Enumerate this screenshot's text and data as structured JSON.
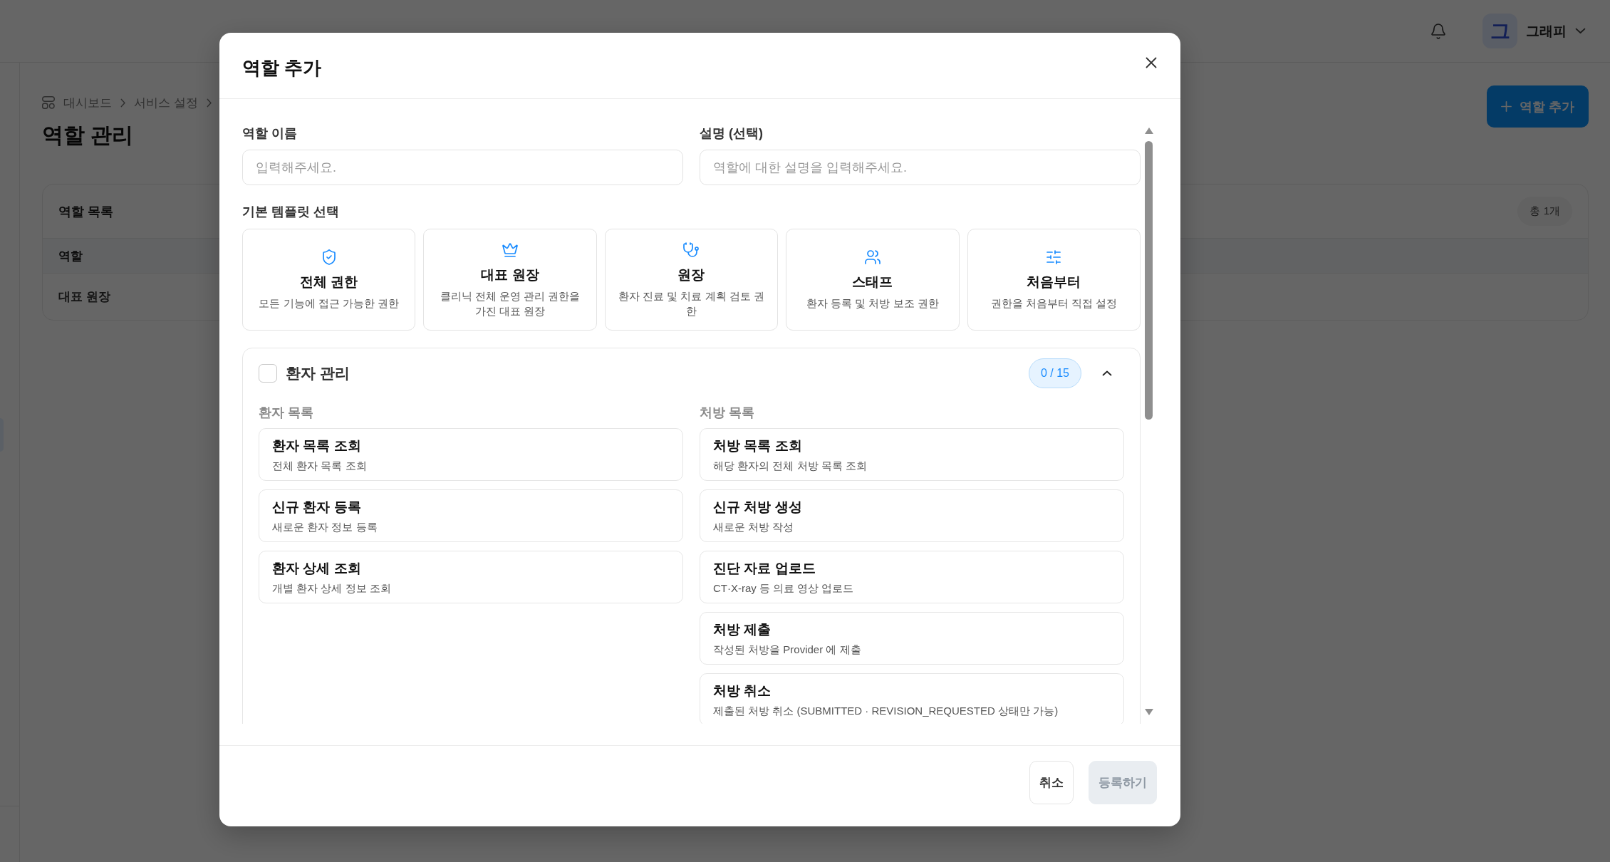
{
  "top_bar": {
    "user": {
      "avatar_initial": "그",
      "name": "그래피"
    }
  },
  "breadcrumbs": [
    "대시보드",
    "서비스 설정"
  ],
  "page_title": "역할 관리",
  "add_role_button": {
    "label": "역할 추가"
  },
  "role_list": {
    "title": "역할 목록",
    "total": "총 1개",
    "column_header": "역할",
    "rows": [
      {
        "name": "대표 원장"
      }
    ]
  },
  "modal": {
    "title": "역할 추가",
    "fields": [
      {
        "label": "역할 이름",
        "placeholder": "입력해주세요."
      },
      {
        "label": "설명 (선택)",
        "placeholder": "역할에 대한 설명을 입력해주세요."
      }
    ],
    "template_heading": "기본 템플릿 선택",
    "templates": [
      {
        "kind": "shield",
        "title": "전체 권한",
        "description": "모든 기능에 접근 가능한 권한",
        "selected": false
      },
      {
        "kind": "crown",
        "title": "대표 원장",
        "description": "클리닉 전체 운영 관리 권한을 가진 대표 원장",
        "selected": false
      },
      {
        "kind": "stethoscope",
        "title": "원장",
        "description": "환자 진료 및 치료 계획 검토 권한",
        "selected": false
      },
      {
        "kind": "people",
        "title": "스태프",
        "description": "환자 등록 및 처방 보조 권한",
        "selected": false
      },
      {
        "kind": "sliders",
        "title": "처음부터",
        "description": "권한을 처음부터 직접 설정",
        "selected": false
      }
    ],
    "permission_groups": [
      {
        "title": "환자 관리",
        "checked": false,
        "count": "0 / 15",
        "expanded": true,
        "sections": [
          {
            "title": "환자 목록",
            "items": [
              {
                "title": "환자 목록 조회",
                "description": "전체 환자 목록 조회",
                "selected": false
              },
              {
                "title": "신규 환자 등록",
                "description": "새로운 환자 정보 등록",
                "selected": false
              },
              {
                "title": "환자 상세 조회",
                "description": "개별 환자 상세 정보 조회",
                "selected": false
              }
            ]
          },
          {
            "title": "처방 목록",
            "items": [
              {
                "title": "처방 목록 조회",
                "description": "해당 환자의 전체 처방 목록 조회",
                "selected": false
              },
              {
                "title": "신규 처방 생성",
                "description": "새로운 처방 작성",
                "selected": false
              },
              {
                "title": "진단 자료 업로드",
                "description": "CT·X-ray 등 의료 영상 업로드",
                "selected": false
              },
              {
                "title": "처방 제출",
                "description": "작성된 처방을 Provider 에 제출",
                "selected": false
              },
              {
                "title": "처방 취소",
                "description": "제출된 처방 취소 (SUBMITTED · REVISION_REQUESTED 상태만 가능)",
                "selected": false
              }
            ]
          }
        ]
      }
    ],
    "buttons": [
      {
        "kind": "secondary",
        "label": "취소",
        "disabled": false
      },
      {
        "kind": "primary",
        "label": "등록하기",
        "disabled": true
      }
    ]
  }
}
